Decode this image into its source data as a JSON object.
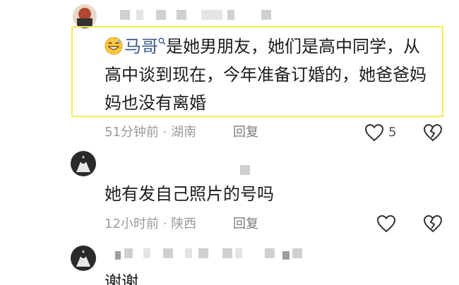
{
  "comments": [
    {
      "mention": "马哥",
      "text_line1": "是她男朋友，她们是高中同学，从",
      "text_line2": "高中谈到现在，今年准备订婚的，她爸爸妈",
      "text_line3": "妈也没有离婚",
      "time_location": "51分钟前 · 湖南",
      "reply_label": "回复",
      "like_count": "5",
      "mention_emoji": "grinning-sweat-emoji"
    },
    {
      "text": "她有发自己照片的号吗",
      "time_location": "12小时前 · 陕西",
      "reply_label": "回复"
    },
    {
      "text": "谢谢"
    }
  ],
  "colors": {
    "highlight": "#f1ea5a",
    "mention": "#3b5a8a",
    "meta": "#9a9a9a"
  }
}
